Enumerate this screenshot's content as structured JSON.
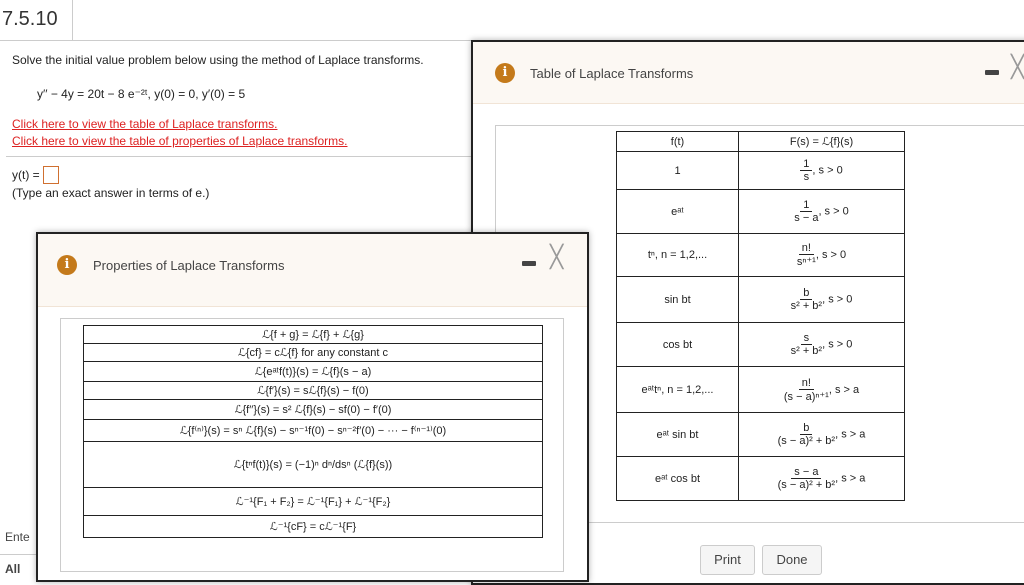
{
  "question_number": "7.5.10",
  "prompt": "Solve the initial value problem below using the method of Laplace transforms.",
  "equation": "y′′ − 4y = 20t − 8 e⁻²ᵗ, y(0) = 0, y′(0) = 5",
  "links": {
    "table": "Click here to view the table of Laplace transforms.",
    "properties": "Click here to view the table of properties of Laplace transforms."
  },
  "answer": {
    "label": "y(t) =",
    "value": "",
    "hint": "(Type an exact answer in terms of e.)"
  },
  "background_text": {
    "enter": "Ente",
    "all": "All"
  },
  "table_dialog": {
    "title": "Table of Laplace Transforms",
    "headers": [
      "f(t)",
      "F(s) = ℒ{f}(s)"
    ],
    "rows": [
      {
        "f": "1",
        "num": "1",
        "den": "s",
        "cond": ", s > 0"
      },
      {
        "f": "eᵃᵗ",
        "num": "1",
        "den": "s − a",
        "cond": ", s > 0"
      },
      {
        "f": "tⁿ, n = 1,2,...",
        "num": "n!",
        "den": "sⁿ⁺¹",
        "cond": ", s > 0"
      },
      {
        "f": "sin bt",
        "num": "b",
        "den": "s² + b²",
        "cond": ", s > 0"
      },
      {
        "f": "cos bt",
        "num": "s",
        "den": "s² + b²",
        "cond": ", s > 0"
      },
      {
        "f": "eᵃᵗtⁿ, n = 1,2,...",
        "num": "n!",
        "den": "(s − a)ⁿ⁺¹",
        "cond": ", s > a"
      },
      {
        "f": "eᵃᵗ sin bt",
        "num": "b",
        "den": "(s − a)² + b²",
        "cond": ", s > a"
      },
      {
        "f": "eᵃᵗ cos bt",
        "num": "s − a",
        "den": "(s − a)² + b²",
        "cond": ", s > a"
      }
    ],
    "print_label": "Print",
    "done_label": "Done"
  },
  "properties_dialog": {
    "title": "Properties of Laplace Transforms",
    "rows": [
      "ℒ{f + g} = ℒ{f} + ℒ{g}",
      "ℒ{cf} = cℒ{f} for any constant c",
      "ℒ{eᵃᵗf(t)}(s) = ℒ{f}(s − a)",
      "ℒ{f′}(s) = sℒ{f}(s) − f(0)",
      "ℒ{f′′}(s) = s² ℒ{f}(s) − sf(0) − f′(0)",
      "ℒ{f⁽ⁿ⁾}(s) = sⁿ ℒ{f}(s) − sⁿ⁻¹f(0) − sⁿ⁻²f′(0) − ··· − f⁽ⁿ⁻¹⁾(0)",
      "ℒ{tⁿf(t)}(s) = (−1)ⁿ dⁿ/dsⁿ (ℒ{f}(s))",
      "ℒ⁻¹{F₁ + F₂} = ℒ⁻¹{F₁} + ℒ⁻¹{F₂}",
      "ℒ⁻¹{cF} = cℒ⁻¹{F}"
    ]
  }
}
